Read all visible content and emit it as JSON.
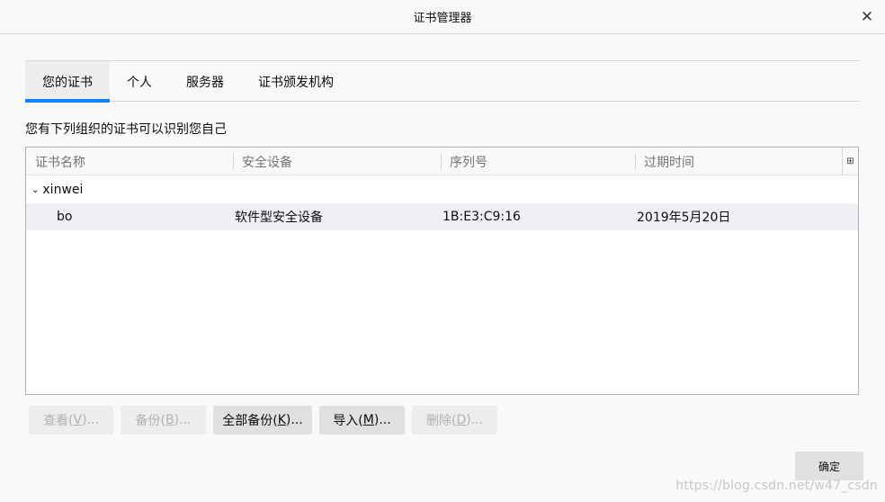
{
  "window": {
    "title": "证书管理器",
    "close_glyph": "✕"
  },
  "tabs": [
    {
      "label": "您的证书",
      "active": true
    },
    {
      "label": "个人",
      "active": false
    },
    {
      "label": "服务器",
      "active": false
    },
    {
      "label": "证书颁发机构",
      "active": false
    }
  ],
  "description": "您有下列组织的证书可以识别您自己",
  "table": {
    "columns": [
      "证书名称",
      "安全设备",
      "序列号",
      "过期时间"
    ],
    "column_picker_glyph": "⊞",
    "group": {
      "twisty": "⌄",
      "name": "xinwei"
    },
    "rows": [
      {
        "name": "bo",
        "device": "软件型安全设备",
        "serial": "1B:E3:C9:16",
        "expires": "2019年5月20日"
      }
    ]
  },
  "buttons": {
    "view": {
      "label": "查看(",
      "key": "V",
      "suffix": ")...",
      "enabled": false
    },
    "backup": {
      "label": "备份(",
      "key": "B",
      "suffix": ")...",
      "enabled": false
    },
    "backup_all": {
      "label": "全部备份(",
      "key": "K",
      "suffix": ")...",
      "enabled": true
    },
    "import": {
      "label": "导入(",
      "key": "M",
      "suffix": ")...",
      "enabled": true
    },
    "delete": {
      "label": "删除(",
      "key": "D",
      "suffix": ")...",
      "enabled": false
    }
  },
  "ok_button": "确定",
  "watermark": "https://blog.csdn.net/w47_csdn",
  "colors": {
    "accent": "#0a84ff",
    "background": "#f9f9fa"
  }
}
